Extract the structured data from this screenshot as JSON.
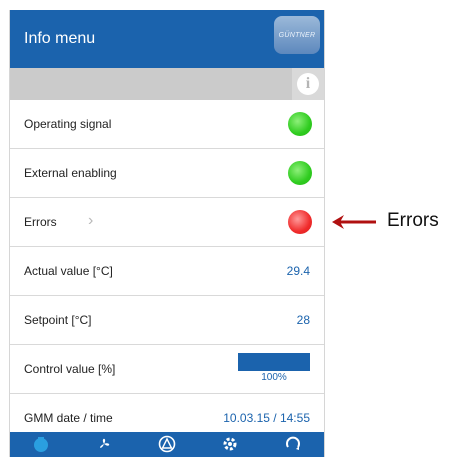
{
  "header": {
    "title": "Info menu",
    "logo_text": "GÜNTNER",
    "brand_color": "#1b63ad"
  },
  "info_icon": "i",
  "rows": [
    {
      "label": "Operating signal",
      "status": "green"
    },
    {
      "label": "External enabling",
      "status": "green"
    },
    {
      "label": "Errors",
      "status": "red",
      "chevron": "›"
    },
    {
      "label": "Actual value [°C]",
      "value": "29.4"
    },
    {
      "label": "Setpoint [°C]",
      "value": "28"
    },
    {
      "label": "Control value [%]",
      "progress": 1.0,
      "progress_label": "100%"
    },
    {
      "label": "GMM date / time",
      "value": "10.03.15 / 14:55"
    }
  ],
  "colors": {
    "green": "#2fcc1f",
    "red": "#f02b2b",
    "arrow": "#b01010"
  },
  "navbar": [
    "home-icon",
    "fan-icon",
    "warning-icon",
    "settings-icon",
    "refresh-icon"
  ],
  "annotation": {
    "text": "Errors"
  }
}
